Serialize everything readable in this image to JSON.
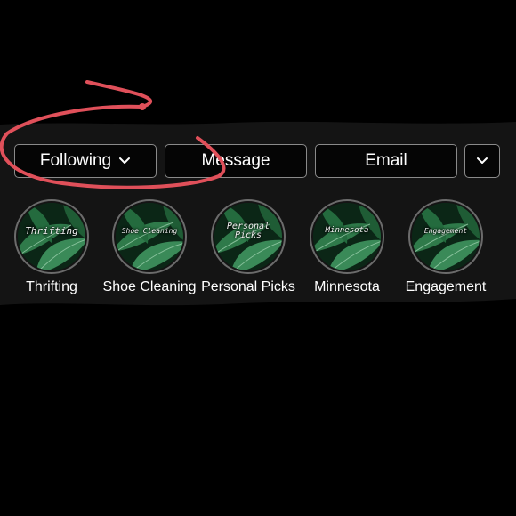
{
  "profile_actions": {
    "following_label": "Following",
    "message_label": "Message",
    "email_label": "Email"
  },
  "highlights": [
    {
      "label": "Thrifting",
      "cover_text": "Thrifting"
    },
    {
      "label": "Shoe Cleaning",
      "cover_text": "Shoe Cleaning"
    },
    {
      "label": "Personal Picks",
      "cover_text": "Personal\nPicks"
    },
    {
      "label": "Minnesota",
      "cover_text": "Minnesota"
    },
    {
      "label": "Engagement",
      "cover_text": "Engagement"
    }
  ],
  "icons": {
    "following_dropdown": "chevron-down-icon",
    "more_dropdown": "chevron-down-icon"
  },
  "colors": {
    "background": "#000000",
    "strip": "#141414",
    "button_border": "#8a8a8a",
    "annotation_red": "#e0505a",
    "leaf_green": "#2f7a4a"
  }
}
